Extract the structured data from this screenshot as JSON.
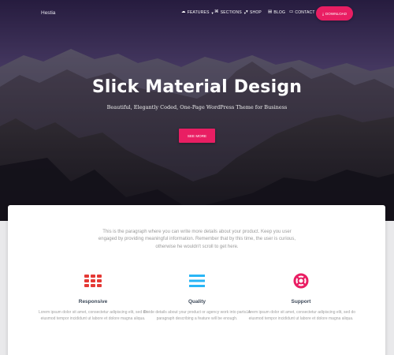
{
  "navbar": {
    "brand": "Hestia",
    "items": [
      {
        "label": "FEATURES",
        "icon": "grid-icon",
        "has_dropdown": true
      },
      {
        "label": "SECTIONS",
        "icon": "book-icon",
        "has_dropdown": true
      },
      {
        "label": "SHOP",
        "icon": "cart-icon",
        "has_dropdown": false
      },
      {
        "label": "BLOG",
        "icon": "document-icon",
        "has_dropdown": false
      },
      {
        "label": "CONTACT",
        "icon": "chat-icon",
        "has_dropdown": false
      }
    ],
    "download_label": "DOWNLOAD"
  },
  "hero": {
    "title": "Slick Material Design",
    "subtitle": "Beautiful, Elegantly Coded, One-Page WordPress Theme for Business",
    "cta_label": "SEE MORE"
  },
  "intro": {
    "text": "This is the paragraph where you can write more details about your product. Keep you user engaged by providing meaningful information. Remember that by this time, the user is curious, otherwise he wouldn't scroll to get here."
  },
  "features": [
    {
      "title": "Responsive",
      "icon": "grid-apps-icon",
      "color": "#e53935",
      "text": "Lorem ipsum dolor sit amet, consectetur adipiscing elit, sed do eiusmod tempor incididunt ut labore et dolore magna aliqua."
    },
    {
      "title": "Quality",
      "icon": "menu-lines-icon",
      "color": "#29b6f6",
      "text": "Divide details about your product or agency work into parts. A paragraph describing a feature will be enough."
    },
    {
      "title": "Support",
      "icon": "lifebuoy-icon",
      "color": "#e91e63",
      "text": "Lorem ipsum dolor sit amet, consectetur adipiscing elit, sed do eiusmod tempor incididunt ut labore et dolore magna aliqua."
    }
  ],
  "colors": {
    "accent": "#e91e63",
    "heading": "#3c4858",
    "muted": "#a0a0a0"
  }
}
